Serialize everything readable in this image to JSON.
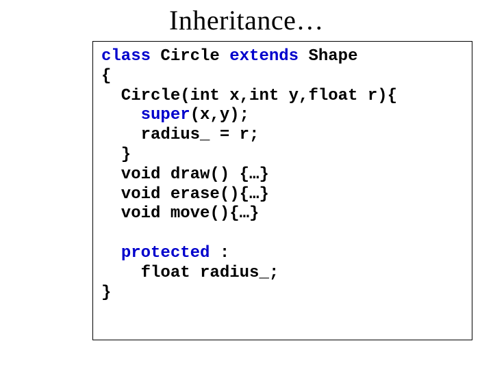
{
  "title": "Inheritance…",
  "code": {
    "l1": {
      "a": "class",
      "b": " Circle ",
      "c": "extends",
      "d": " Shape"
    },
    "l2": "{",
    "l3": "  Circle(int x,int y,float r){",
    "l4": {
      "a": "    ",
      "b": "super",
      "c": "(x,y);"
    },
    "l5": "    radius_ = r;",
    "l6": "  }",
    "l7": "  void draw() {…}",
    "l8": "  void erase(){…}",
    "l9": "  void move(){…}",
    "l10": "",
    "l11": {
      "a": "  ",
      "b": "protected",
      "c": " :"
    },
    "l12": "    float radius_;",
    "l13": "}"
  }
}
